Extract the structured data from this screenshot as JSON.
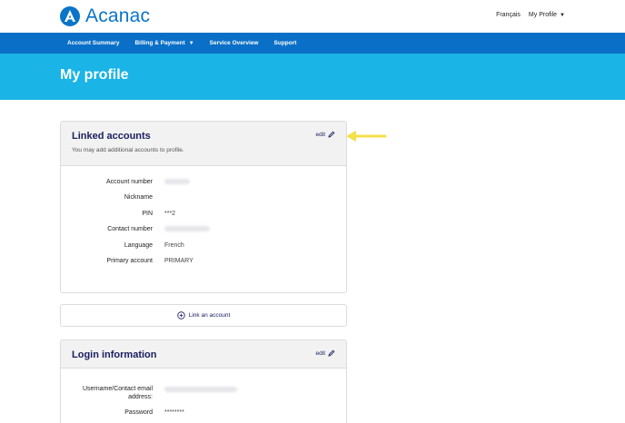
{
  "brand": {
    "name": "Acanac",
    "color": "#0a74c9"
  },
  "header": {
    "language_link": "Français",
    "profile_menu": "My Profile"
  },
  "nav": {
    "items": [
      {
        "label": "Account Summary"
      },
      {
        "label": "Billing & Payment",
        "has_dropdown": true
      },
      {
        "label": "Service Overview"
      },
      {
        "label": "Support"
      }
    ]
  },
  "page": {
    "title": "My profile"
  },
  "linked_accounts": {
    "title": "Linked accounts",
    "subtitle": "You may add additional accounts to profile.",
    "edit_label": "edit",
    "fields": [
      {
        "label": "Account number",
        "value": ""
      },
      {
        "label": "Nickname",
        "value": ""
      },
      {
        "label": "PIN",
        "value": "***2"
      },
      {
        "label": "Contact number",
        "value": ""
      },
      {
        "label": "Language",
        "value": "French"
      },
      {
        "label": "Primary account",
        "value": "PRIMARY"
      }
    ]
  },
  "link_account": {
    "label": "Link an account",
    "icon": "plus-circle-icon"
  },
  "login_info": {
    "title": "Login information",
    "edit_label": "edit",
    "fields": [
      {
        "label_line1": "Username/Contact email",
        "label_line2": "address:",
        "value": ""
      },
      {
        "label": "Password",
        "value": "********"
      }
    ]
  },
  "colors": {
    "nav_bg": "#0a6fc6",
    "hero_bg": "#1ab4e6",
    "arrow": "#f3e04a",
    "title_text": "#1a2060"
  }
}
